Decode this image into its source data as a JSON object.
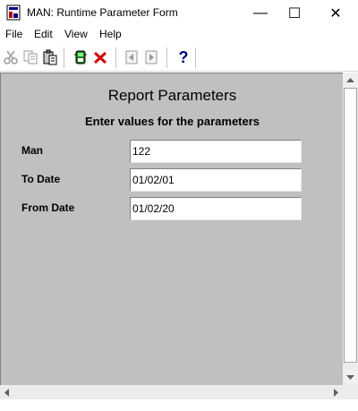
{
  "window": {
    "title": "MAN: Runtime Parameter Form",
    "minimize_glyph": "—",
    "maximize_glyph": "☐",
    "close_glyph": "✕"
  },
  "menu": {
    "items": [
      {
        "label": "File"
      },
      {
        "label": "Edit"
      },
      {
        "label": "View"
      },
      {
        "label": "Help"
      }
    ]
  },
  "toolbar": {
    "icons": [
      "cut-icon",
      "copy-icon",
      "paste-icon",
      "run-report-icon",
      "cancel-icon",
      "previous-page-icon",
      "next-page-icon",
      "help-icon"
    ],
    "help_glyph": "?"
  },
  "form": {
    "title": "Report Parameters",
    "subtitle": "Enter values for the parameters",
    "parameters": [
      {
        "label": "Man",
        "value": "122"
      },
      {
        "label": "To Date",
        "value": "01/02/01"
      },
      {
        "label": "From Date",
        "value": "01/02/20"
      }
    ]
  },
  "colors": {
    "form_background": "#c0c0c0",
    "cancel_red": "#d40000",
    "help_blue": "#000080"
  }
}
